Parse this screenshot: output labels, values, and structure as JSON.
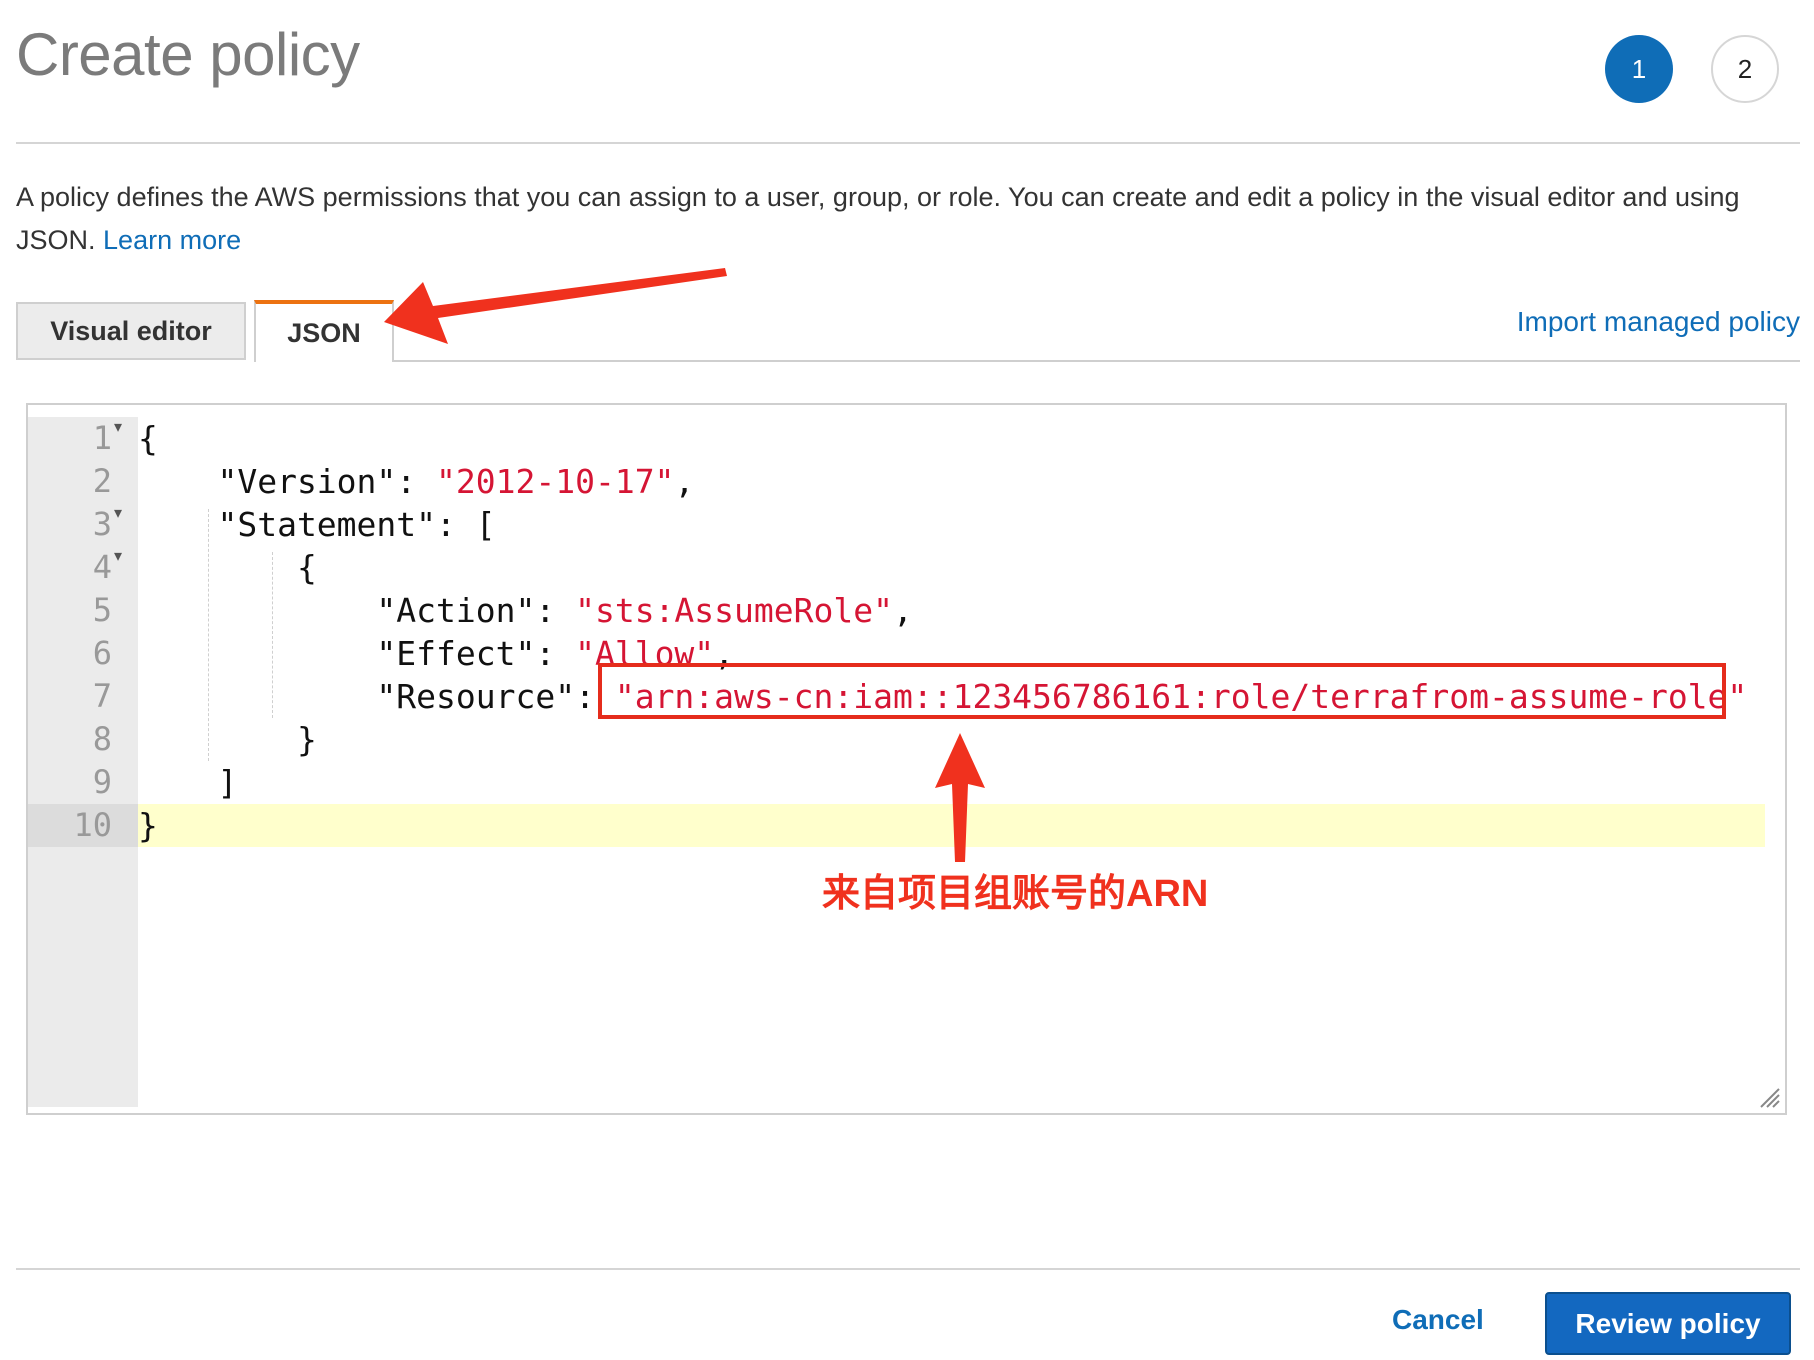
{
  "header": {
    "title": "Create policy",
    "steps": [
      "1",
      "2"
    ],
    "active_step": "1"
  },
  "intro": {
    "text": "A policy defines the AWS permissions that you can assign to a user, group, or role. You can create and edit a policy in the visual editor and using JSON.",
    "learn_more": "Learn more"
  },
  "tabs": [
    {
      "label": "Visual editor",
      "selected": false
    },
    {
      "label": "JSON",
      "selected": true
    }
  ],
  "import_link": "Import managed policy",
  "editor": {
    "lines": [
      {
        "num": "1",
        "fold": true,
        "text": "{"
      },
      {
        "num": "2",
        "fold": false,
        "text": "    \"Version\": \"2012-10-17\","
      },
      {
        "num": "3",
        "fold": true,
        "text": "    \"Statement\": ["
      },
      {
        "num": "4",
        "fold": true,
        "text": "        {"
      },
      {
        "num": "5",
        "fold": false,
        "text": "            \"Action\": \"sts:AssumeRole\","
      },
      {
        "num": "6",
        "fold": false,
        "text": "            \"Effect\": \"Allow\","
      },
      {
        "num": "7",
        "fold": false,
        "text": "            \"Resource\": \"arn:aws-cn:iam::123456786161:role/terrafrom-assume-role\""
      },
      {
        "num": "8",
        "fold": false,
        "text": "        }"
      },
      {
        "num": "9",
        "fold": false,
        "text": "    ]"
      },
      {
        "num": "10",
        "fold": false,
        "text": "}"
      }
    ],
    "active_line": "10"
  },
  "annotation": {
    "text": "来自项目组账号的ARN",
    "color": "#f0311e"
  },
  "footer": {
    "cancel": "Cancel",
    "primary": "Review policy"
  },
  "colors": {
    "link": "#0f6db7",
    "primary": "#1368c0",
    "tab_accent": "#ec7211",
    "string": "#d51534",
    "active_line": "#ffffcc"
  }
}
